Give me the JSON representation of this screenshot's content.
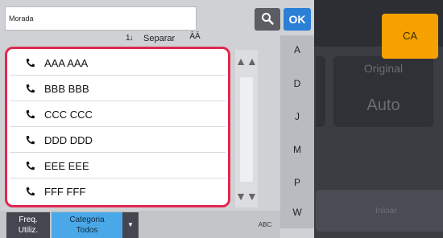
{
  "background": {
    "original_label": "Original",
    "original_value": "Auto",
    "iniciar_label": "Iniciar",
    "ca_label": "CA"
  },
  "search": {
    "label": "Morada",
    "value": "",
    "ok_label": "OK",
    "search_icon": "search-icon"
  },
  "sort": {
    "icon_text": "1↓",
    "label": "Separar",
    "az_icon": "az-sort-icon",
    "az_text": "ĀĀ"
  },
  "contacts": [
    {
      "name": "AAA AAA",
      "icon": "phone-icon"
    },
    {
      "name": "BBB BBB",
      "icon": "phone-icon"
    },
    {
      "name": "CCC CCC",
      "icon": "phone-icon"
    },
    {
      "name": "DDD DDD",
      "icon": "phone-icon"
    },
    {
      "name": "EEE EEE",
      "icon": "phone-icon"
    },
    {
      "name": "FFF FFF",
      "icon": "phone-icon"
    }
  ],
  "scroll": {
    "up_icon": "double-chevron-up-icon",
    "down_icon": "double-chevron-down-icon"
  },
  "alphabet_index": [
    "A",
    "D",
    "J",
    "M",
    "P",
    "W"
  ],
  "bottom": {
    "freq_line1": "Freq.",
    "freq_line2": "Utiliz.",
    "category_line1": "Categoria",
    "category_line2": "Todos",
    "abc_label": "ABC"
  },
  "colors": {
    "highlight_border": "#e0284f",
    "ok_button": "#2a7fd6",
    "ca_button": "#f5a100",
    "category_tab": "#4aa8e8"
  }
}
